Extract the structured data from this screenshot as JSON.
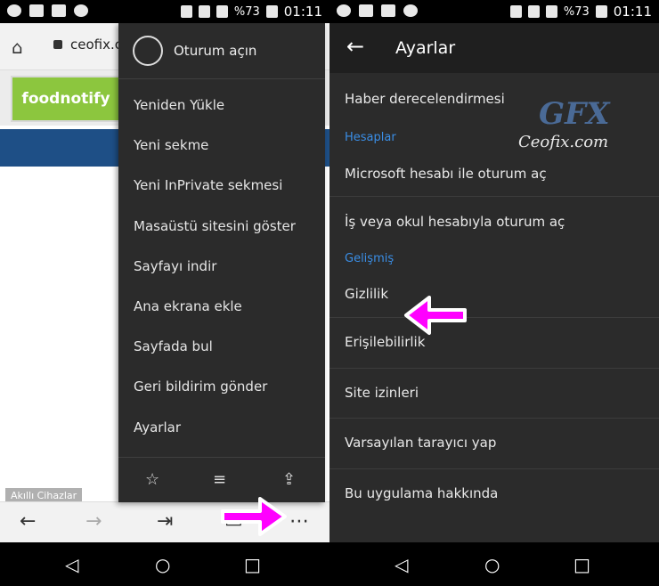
{
  "status": {
    "percent": "%73",
    "time": "01:11"
  },
  "left": {
    "url": "ceofix.co",
    "logo_text": "foodnotify",
    "side_label": "Akıllı Cihazlar",
    "menu": {
      "signin": "Oturum açın",
      "items": [
        "Yeniden Yükle",
        "Yeni sekme",
        "Yeni InPrivate sekmesi",
        "Masaüstü sitesini göster",
        "Sayfayı indir",
        "Ana ekrana ekle",
        "Sayfada bul",
        "Geri bildirim gönder",
        "Ayarlar"
      ]
    }
  },
  "right": {
    "title": "Ayarlar",
    "item_news": "Haber derecelendirmesi",
    "section_accounts": "Hesaplar",
    "item_ms": "Microsoft hesabı ile oturum aç",
    "item_work": "İş veya okul hesabıyla oturum aç",
    "section_advanced": "Gelişmiş",
    "item_privacy": "Gizlilik",
    "item_access": "Erişilebilirlik",
    "item_site": "Site izinleri",
    "item_default": "Varsayılan tarayıcı yap",
    "item_about": "Bu uygulama hakkında"
  },
  "watermark": {
    "gfx": "GFX",
    "text": "Ceofix.com"
  },
  "colors": {
    "accent_blue": "#3a8ee6",
    "arrow_magenta": "#ff00ff",
    "menu_bg": "#2b2b2b"
  }
}
